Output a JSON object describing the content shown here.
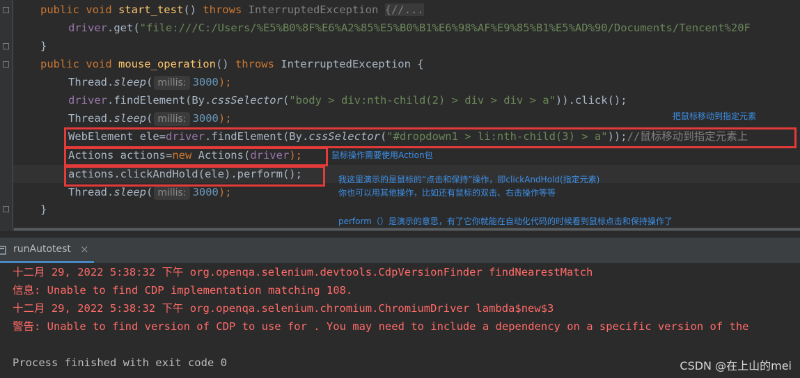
{
  "colors": {
    "editor_bg": "#2b2b2b",
    "keyword": "#cc7832",
    "method": "#ffc66d",
    "string": "#6a8759",
    "field": "#9876aa",
    "number": "#6897bb",
    "highlight_box": "#e33a3a",
    "annotation": "#3d8fe6",
    "console_error": "#ff6b68"
  },
  "code": {
    "l1": {
      "kw1": "public void ",
      "fn": "start_test",
      "paren": "() ",
      "kw2": "throws",
      "exc": " InterruptedException ",
      "fold": "{//..."
    },
    "l2": {
      "obj": "driver",
      "call": ".get(",
      "str": "\"file:///C:/Users/%E5%B0%8F%E6%A2%85%E5%B0%B1%E6%98%AF%E9%85%B1%E5%AD%90/Documents/Tencent%20F"
    },
    "l3": {
      "text": "}"
    },
    "l4": {
      "kw1": "public void ",
      "fn": "mouse_operation",
      "paren": "() ",
      "kw2": "throws",
      "exc": " InterruptedException {"
    },
    "l5": {
      "cls": "Thread.",
      "m": "sleep",
      "open": "(",
      "hint": "millis:",
      "num": "3000",
      "close": ");"
    },
    "l6": {
      "obj": "driver",
      "a": ".findElement(By.",
      "m": "cssSelector",
      "open": "(",
      "str": "\"body > div:nth-child(2) > div > div > a\"",
      "close": ")).click();"
    },
    "l7": {
      "cls": "Thread.",
      "m": "sleep",
      "open": "(",
      "hint": "millis:",
      "num": "3000",
      "close": ");"
    },
    "l8": {
      "a": "WebElement ele=",
      "obj": "driver",
      "b": ".findElement(By.",
      "m": "cssSelector",
      "open": "(",
      "str": "\"#dropdown1 > li:nth-child(3) > a\"",
      "close": "));",
      "cmt": "//鼠标移动到指定元素上"
    },
    "l9": {
      "a": "Actions actions=",
      "kw": "new",
      "b": " Actions(",
      "obj": "driver",
      "close": ");"
    },
    "l10": {
      "text": "actions.clickAndHold(ele).perform();"
    },
    "l11": {
      "cls": "Thread.",
      "m": "sleep",
      "open": "(",
      "hint": "millis:",
      "num": "3000",
      "close": ");"
    },
    "l12": {
      "text": "}"
    }
  },
  "annotations": {
    "move_to": "把鼠标移动到指定元素",
    "action_pkg": "鼠标操作需要使用Action包",
    "click_hold_1": "我这里演示的是鼠标的“点击和保持”操作，即clickAndHold(指定元素)",
    "click_hold_2": "你也可以用其他操作，比如还有鼠标的双击、右击操作等等",
    "perform": "perform（）是演示的意思，有了它你就能在自动化代码的时候看到鼠标点击和保持操作了"
  },
  "run_panel": {
    "tab_label": "runAutotest",
    "close": "×"
  },
  "console": {
    "lines": [
      "十二月 29, 2022 5:38:32 下午 org.openqa.selenium.devtools.CdpVersionFinder findNearestMatch",
      "信息: Unable to find CDP implementation matching 108.",
      "十二月 29, 2022 5:38:32 下午 org.openqa.selenium.chromium.ChromiumDriver lambda$new$3",
      "警告: Unable to find version of CDP to use for . You may need to include a dependency on a specific version of the",
      "Process finished with exit code 0"
    ]
  },
  "watermark": "CSDN @在上山的mei"
}
